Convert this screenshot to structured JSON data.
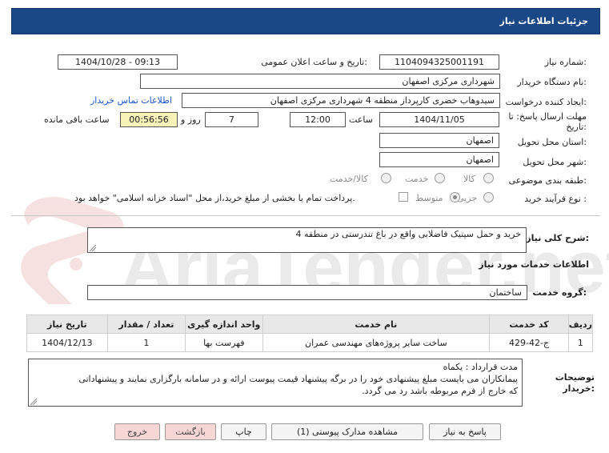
{
  "header": {
    "title": "جزئیات اطلاعات نیاز"
  },
  "form": {
    "need_number_label": "شماره نیاز:",
    "need_number": "1104094325001191",
    "announce_label": "تاریخ و ساعت اعلان عمومی:",
    "announce_value": "1404/10/28 - 09:13",
    "buyer_org_label": "نام دستگاه خریدار:",
    "buyer_org": "شهرداری مرکزی اصفهان",
    "creator_label": "ایجاد کننده درخواست:",
    "creator": "سیدوهاب خضری کارپرداز منطقه 4 شهرداری مرکزی اصفهان",
    "contact_link": "اطلاعات تماس خریدار",
    "deadline_label_1": "مهلت ارسال پاسخ: تا",
    "deadline_label_2": "تاریخ:",
    "deadline_date": "1404/11/05",
    "time_label": "ساعت",
    "deadline_time": "12:00",
    "days_value": "7",
    "days_label": "روز و",
    "remaining_time": "00:56:56",
    "remaining_label": "ساعت باقی مانده",
    "province_label": "استان محل تحویل:",
    "province": "اصفهان",
    "city_label": "شهر محل تحویل:",
    "city": "اصفهان",
    "category_label": "طبقه بندی موضوعی:",
    "category_options": [
      "کالا",
      "خدمت",
      "کالا/خدمت"
    ],
    "process_label": "نوع فرآیند خرید :",
    "process_options": [
      "جزیی",
      "متوسط"
    ],
    "payment_note": "پرداخت تمام یا بخشی از مبلغ خرید،از محل \"اسناد خزانه اسلامی\" خواهد بود."
  },
  "summary": {
    "label": "شرح کلی نیاز:",
    "value": "خرید و حمل سپتیک فاضلابی واقع در باغ تندرستی در منطقه 4"
  },
  "services": {
    "section_title": "اطلاعات خدمات مورد نیاز",
    "group_label": "گروه خدمت:",
    "group_value": "ساختمان",
    "columns": [
      "ردیف",
      "کد خدمت",
      "نام خدمت",
      "واحد اندازه گیری",
      "تعداد / مقدار",
      "تاریخ نیاز"
    ],
    "rows": [
      {
        "row": "1",
        "code": "ج-42-429",
        "name": "ساخت سایر پروژه‌های مهندسی عمران",
        "unit": "فهرست بها",
        "qty": "1",
        "date": "1404/12/13"
      }
    ]
  },
  "notes": {
    "label_1": "توضیحات",
    "label_2": "خریدار:",
    "line1": "مدت قرارداد : یکماه",
    "line2": "پیمانکاران می بایست مبلغ پیشنهادی خود را در برگه پیشنهاد قیمت پیوست ارائه و در سامانه بارگزاری نمایند و پیشنهاداتی",
    "line3": "که خارج از فرم مربوطه باشد رد می گردد."
  },
  "buttons": {
    "reply": "پاسخ به نیاز",
    "attachments": "مشاهده مدارک پیوستی (1)",
    "print": "چاپ",
    "back": "بازگشت",
    "exit": "خروج"
  },
  "watermark": {
    "text": "AriaTender.net"
  },
  "colors": {
    "header_bg": "#1a4785",
    "link": "#1a56c7",
    "remaining_bg": "#f7f2b8"
  }
}
